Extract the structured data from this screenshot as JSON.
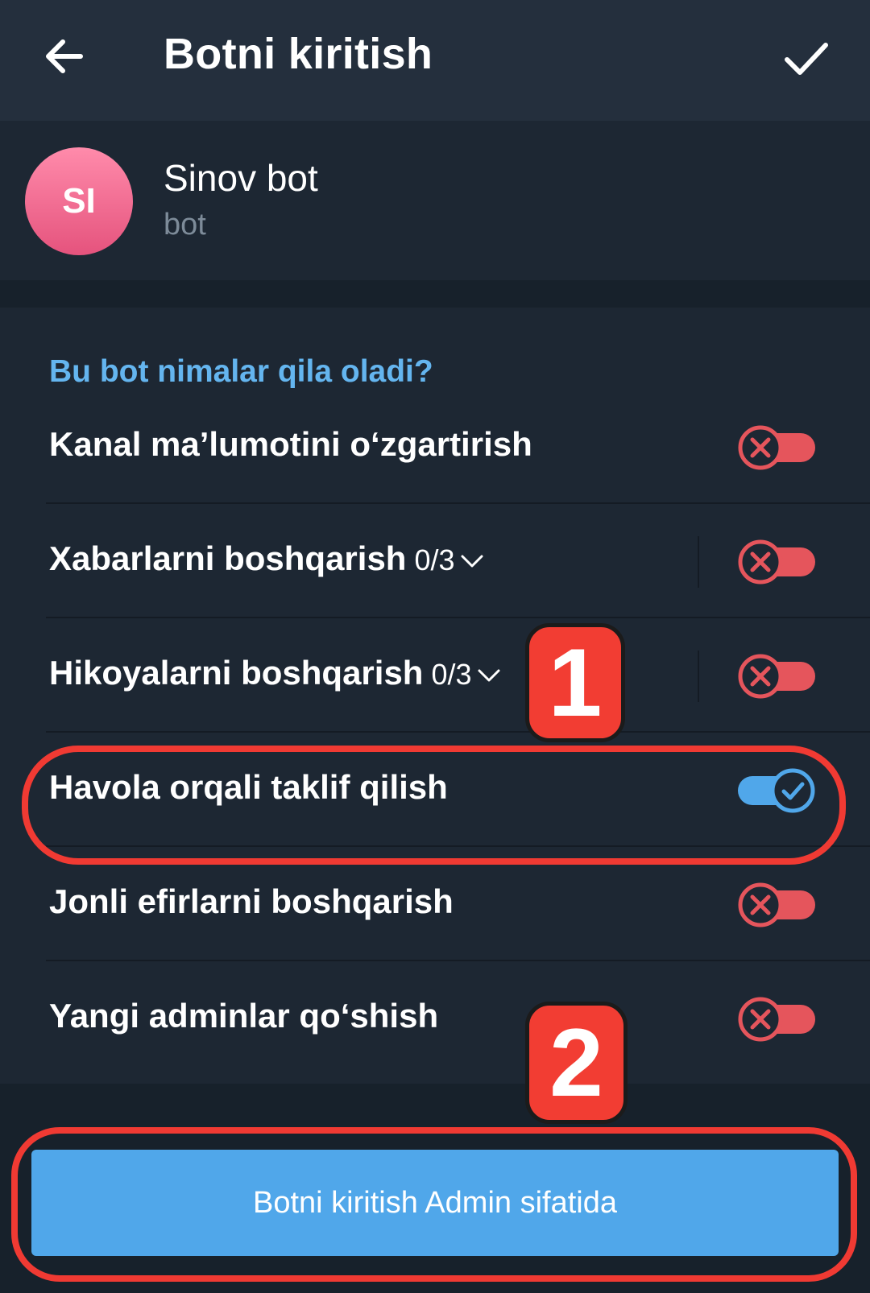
{
  "header": {
    "title": "Botni kiritish",
    "back_icon": "arrow-left-icon",
    "done_icon": "checkmark-icon"
  },
  "profile": {
    "avatar_initials": "SI",
    "name": "Sinov bot",
    "status": "bot"
  },
  "permissions": {
    "section_title": "Bu bot nimalar qila oladi?",
    "items": [
      {
        "label": "Kanal ma’lumotini o‘zgartirish",
        "count": "",
        "enabled": false
      },
      {
        "label": "Xabarlarni boshqarish",
        "count": "0/3",
        "enabled": false
      },
      {
        "label": "Hikoyalarni boshqarish",
        "count": "0/3",
        "enabled": false
      },
      {
        "label": "Havola orqali taklif qilish",
        "count": "",
        "enabled": true
      },
      {
        "label": "Jonli efirlarni boshqarish",
        "count": "",
        "enabled": false
      },
      {
        "label": "Yangi adminlar qo‘shish",
        "count": "",
        "enabled": false
      }
    ]
  },
  "action_button": {
    "label": "Botni kiritish Admin sifatida"
  },
  "annotations": {
    "badge_1": "1",
    "badge_2": "2"
  },
  "colors": {
    "accent_blue": "#50a7ea",
    "section_title": "#64b5ef",
    "toggle_off": "#e5555c",
    "highlight_red": "#f03a33"
  }
}
